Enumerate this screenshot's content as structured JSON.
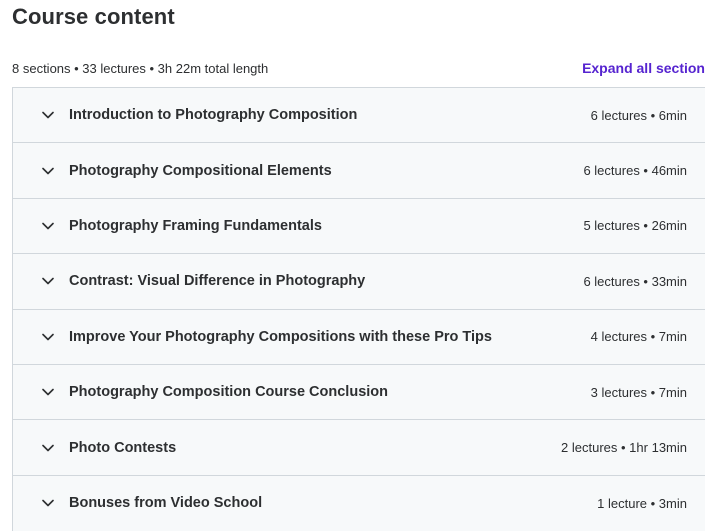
{
  "header": {
    "title": "Course content",
    "summary": "8 sections • 33 lectures • 3h 22m total length",
    "expand_all_label": "Expand all section"
  },
  "sections": [
    {
      "title": "Introduction to Photography Composition",
      "meta": "6 lectures • 6min"
    },
    {
      "title": "Photography Compositional Elements",
      "meta": "6 lectures • 46min"
    },
    {
      "title": "Photography Framing Fundamentals",
      "meta": "5 lectures • 26min"
    },
    {
      "title": "Contrast: Visual Difference in Photography",
      "meta": "6 lectures • 33min"
    },
    {
      "title": "Improve Your Photography Compositions with these Pro Tips",
      "meta": "4 lectures • 7min"
    },
    {
      "title": "Photography Composition Course Conclusion",
      "meta": "3 lectures • 7min"
    },
    {
      "title": "Photo Contests",
      "meta": "2 lectures • 1hr 13min"
    },
    {
      "title": "Bonuses from Video School",
      "meta": "1 lecture • 3min"
    }
  ],
  "icons": {
    "section_toggle": "chevron-down-icon"
  },
  "colors": {
    "accent": "#5624d0",
    "section_bg": "#f7f9fa",
    "border": "#d1d7dc",
    "text": "#2d2f31"
  }
}
